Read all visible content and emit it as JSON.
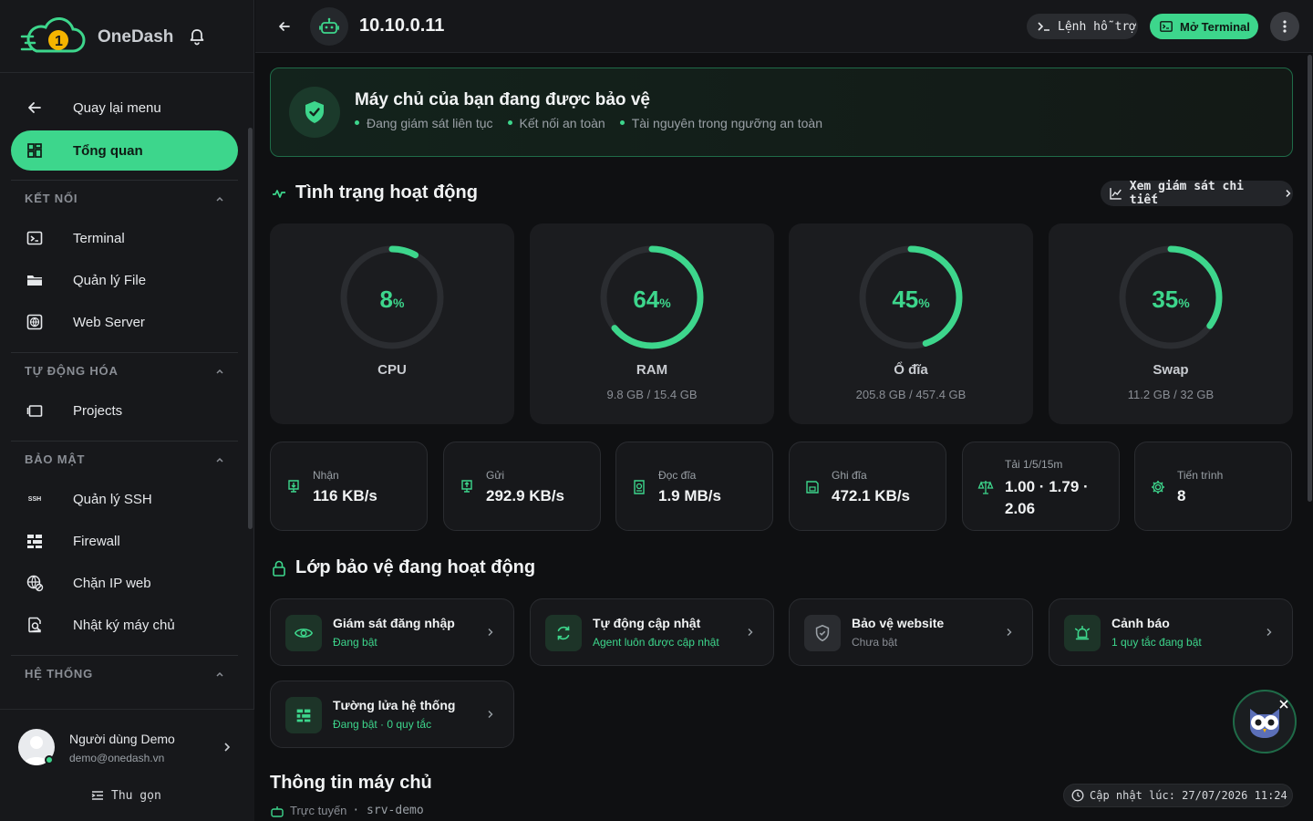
{
  "app": {
    "brand_name": "OneDash",
    "accent_color": "#3dd68c"
  },
  "sidebar": {
    "back": {
      "label": "Quay lại menu",
      "icon": "arrow-left-icon"
    },
    "overview": {
      "label": "Tổng quan",
      "icon": "dashboard-grid-icon"
    },
    "sections": [
      {
        "title": "KẾT NỐI",
        "items": [
          {
            "label": "Terminal",
            "icon": "terminal-icon"
          },
          {
            "label": "Quản lý File",
            "icon": "folder-icon"
          },
          {
            "label": "Web Server",
            "icon": "globe-box-icon"
          }
        ]
      },
      {
        "title": "TỰ ĐỘNG HÓA",
        "items": [
          {
            "label": "Projects",
            "icon": "projects-icon"
          }
        ]
      },
      {
        "title": "BẢO MẬT",
        "items": [
          {
            "label": "Quản lý SSH",
            "icon": "ssh-icon",
            "icon_text": "SSH"
          },
          {
            "label": "Firewall",
            "icon": "firewall-icon"
          },
          {
            "label": "Chặn IP web",
            "icon": "globe-block-icon"
          },
          {
            "label": "Nhật ký máy chủ",
            "icon": "log-search-icon"
          }
        ]
      },
      {
        "title": "HỆ THỐNG",
        "items": []
      }
    ],
    "user": {
      "name": "Người dùng Demo",
      "email": "demo@onedash.vn"
    },
    "collapse_label": "Thu gọn"
  },
  "header": {
    "host": "10.10.0.11",
    "help_label": "Lệnh hỗ trợ",
    "terminal_label": "Mở Terminal"
  },
  "banner": {
    "title": "Máy chủ của bạn đang được bảo vệ",
    "bullets": [
      "Đang giám sát liên tục",
      "Kết nối an toàn",
      "Tài nguyên trong ngưỡng an toàn"
    ]
  },
  "activity": {
    "title": "Tình trạng hoạt động",
    "detail_label": "Xem giám sát chi tiết",
    "gauges": [
      {
        "label": "CPU",
        "value": 8,
        "unit": "%",
        "sub": ""
      },
      {
        "label": "RAM",
        "value": 64,
        "unit": "%",
        "sub": "9.8 GB / 15.4 GB"
      },
      {
        "label": "Ổ đĩa",
        "value": 45,
        "unit": "%",
        "sub": "205.8 GB / 457.4 GB"
      },
      {
        "label": "Swap",
        "value": 35,
        "unit": "%",
        "sub": "11.2 GB / 32 GB"
      }
    ],
    "stats": [
      {
        "label": "Nhận",
        "value": "116 KB/s",
        "icon": "download-icon"
      },
      {
        "label": "Gửi",
        "value": "292.9 KB/s",
        "icon": "upload-icon"
      },
      {
        "label": "Đọc đĩa",
        "value": "1.9 MB/s",
        "icon": "disk-read-icon"
      },
      {
        "label": "Ghi đĩa",
        "value": "472.1 KB/s",
        "icon": "disk-write-icon"
      },
      {
        "label": "Tải 1/5/15m",
        "value": "1.00 · 1.79 · 2.06",
        "icon": "scale-icon"
      },
      {
        "label": "Tiến trình",
        "value": "8",
        "icon": "gear-icon"
      }
    ]
  },
  "protection": {
    "title": "Lớp bảo vệ đang hoạt động",
    "layers": [
      {
        "title": "Giám sát đăng nhập",
        "status": "Đang bật",
        "icon": "eye-icon",
        "active": true
      },
      {
        "title": "Tự động cập nhật",
        "status": "Agent luôn được cập nhật",
        "icon": "refresh-icon",
        "active": true
      },
      {
        "title": "Bảo vệ website",
        "status": "Chưa bật",
        "icon": "shield-check-icon",
        "active": false
      },
      {
        "title": "Cảnh báo",
        "status": "1 quy tắc đang bật",
        "icon": "alarm-icon",
        "active": true
      },
      {
        "title": "Tường lửa hệ thống",
        "status": "Đang bật · 0 quy tắc",
        "icon": "firewall-icon",
        "active": true
      }
    ]
  },
  "server_info": {
    "title": "Thông tin máy chủ",
    "status": "Trực tuyến",
    "hostname": "· srv-demo",
    "updated": "Cập nhật lúc: 27/07/2026 11:24"
  }
}
